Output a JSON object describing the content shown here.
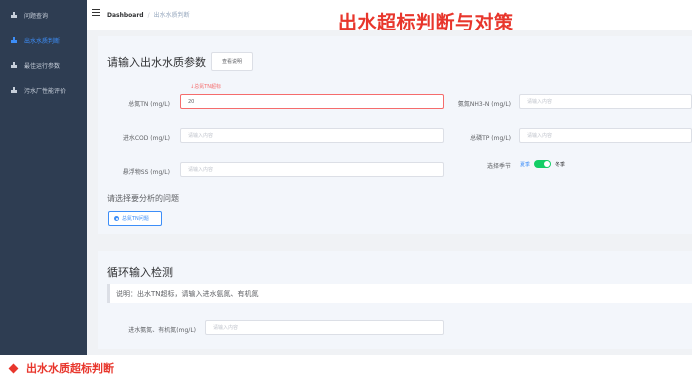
{
  "sidebar": {
    "items": [
      {
        "label": "问题查询",
        "active": false
      },
      {
        "label": "出水水质判断",
        "active": true
      },
      {
        "label": "最佳运行参数",
        "active": false
      },
      {
        "label": "污水厂性能评价",
        "active": false
      }
    ]
  },
  "header": {
    "breadcrumb_root": "Dashboard",
    "breadcrumb_separator": "/",
    "breadcrumb_current": "出水水质判断"
  },
  "overlay_title": "出水超标判断与对策",
  "form": {
    "title": "请输入出水水质参数",
    "help_button": "查看说明",
    "error_message": "↓总氮TN超标",
    "fields": {
      "tn": {
        "label": "总氮TN (mg/L)",
        "value": "20"
      },
      "nh3": {
        "label": "氨氮NH3-N (mg/L)",
        "placeholder": "请输入内容"
      },
      "cod": {
        "label": "进水COD (mg/L)",
        "placeholder": "请输入内容"
      },
      "tp": {
        "label": "总磷TP (mg/L)",
        "placeholder": "请输入内容"
      },
      "ss": {
        "label": "悬浮物SS (mg/L)",
        "placeholder": "请输入内容"
      },
      "season": {
        "label": "选择季节",
        "left": "夏季",
        "right": "冬季",
        "on": true
      }
    },
    "problem_title": "请选择要分析的问题",
    "problem_option": "总氮TN问题"
  },
  "loop": {
    "title": "循环输入检测",
    "note": "说明：出水TN超标，请输入进水氨氮、有机氮",
    "field_label": "进水氨氮、有机氮(mg/L)",
    "field_placeholder": "请输入内容"
  },
  "caption": "出水水质超标判断",
  "colors": {
    "sidebar_bg": "#2e3d52",
    "accent": "#3d8ef8",
    "error": "#f56c6c",
    "title_red": "#e8362c",
    "switch_on": "#13ce66"
  }
}
